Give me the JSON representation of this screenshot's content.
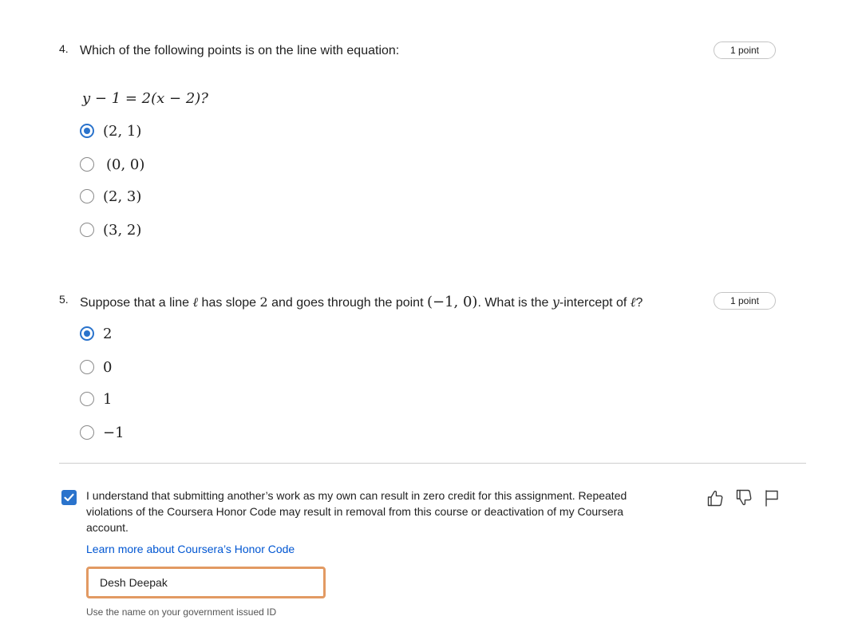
{
  "question4": {
    "number": "4.",
    "prompt": "Which of the following points is on the line with equation:",
    "points": "1 point",
    "equation": "y − 1 = 2(x − 2)?",
    "options": [
      {
        "label": "(2, 1)",
        "selected": true
      },
      {
        "label": "(0, 0)",
        "selected": false
      },
      {
        "label": "(2, 3)",
        "selected": false
      },
      {
        "label": "(3, 2)",
        "selected": false
      }
    ]
  },
  "question5": {
    "number": "5.",
    "prompt_part1": "Suppose that a line ",
    "ell1": "ℓ",
    "prompt_part2": " has slope ",
    "slope": "2",
    "prompt_part3": " and goes through the point ",
    "point": "(−1, 0)",
    "prompt_part4": ". What is the ",
    "y_var": "y",
    "prompt_part5": "-intercept of ",
    "ell2": "ℓ",
    "prompt_part6": "?",
    "points": "1 point",
    "options": [
      {
        "label": "2",
        "selected": true
      },
      {
        "label": "0",
        "selected": false
      },
      {
        "label": "1",
        "selected": false
      },
      {
        "label": "−1",
        "selected": false
      }
    ]
  },
  "honor_code": {
    "checked": true,
    "statement": "I understand that submitting another’s work as my own can result in zero credit for this assignment. Repeated violations of the Coursera Honor Code may result in removal from this course or deactivation of my Coursera account.",
    "link_text": "Learn more about Coursera’s Honor Code",
    "name_value": "Desh Deepak",
    "name_hint": "Use the name on your government issued ID"
  },
  "feedback_icons": [
    "thumbs-up-icon",
    "thumbs-down-icon",
    "flag-icon"
  ],
  "colors": {
    "accent": "#2a73cc",
    "link": "#0056d2",
    "input_focus_border": "#e29a63",
    "divider": "#cfcfcf"
  }
}
